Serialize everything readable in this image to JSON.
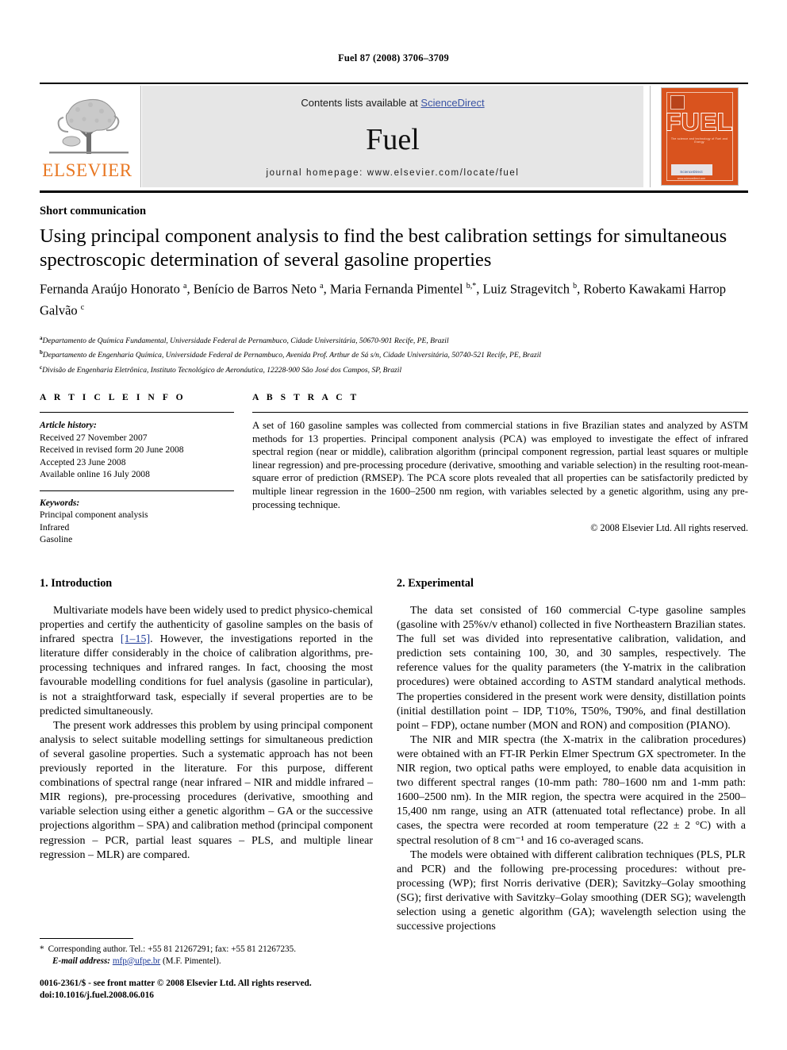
{
  "running_head": "Fuel 87 (2008) 3706–3709",
  "masthead": {
    "publisher_name": "ELSEVIER",
    "publisher_logo_alt": "elsevier-tree-logo",
    "contents_prefix": "Contents lists available at ",
    "contents_link": "ScienceDirect",
    "journal_title": "Fuel",
    "homepage": "journal homepage: www.elsevier.com/locate/fuel",
    "cover": {
      "title": "FUEL",
      "subtitle": "The science and technology of Fuel and Energy",
      "sciencedirect": "ScienceDirect",
      "sciencedirect_label": "available at",
      "url": "www.sciencedirect.com"
    }
  },
  "article": {
    "type": "Short communication",
    "title": "Using principal component analysis to find the best calibration settings for simultaneous spectroscopic determination of several gasoline properties",
    "authors_html": "Fernanda Araújo Honorato <sup>a</sup>, Benício de Barros Neto <sup>a</sup>, Maria Fernanda Pimentel <sup>b,</sup><sup>*</sup>, Luiz Stragevitch <sup>b</sup>, Roberto Kawakami Harrop Galvão <sup>c</sup>",
    "affiliations": [
      "Departamento de Química Fundamental, Universidade Federal de Pernambuco, Cidade Universitária, 50670-901 Recife, PE, Brazil",
      "Departamento de Engenharia Química, Universidade Federal de Pernambuco, Avenida Prof. Arthur de Sá s/n, Cidade Universitária, 50740-521 Recife, PE, Brazil",
      "Divisão de Engenharia Eletrônica, Instituto Tecnológico de Aeronáutica, 12228-900 São José dos Campos, SP, Brazil"
    ],
    "affiliation_marks": [
      "a",
      "b",
      "c"
    ]
  },
  "article_info": {
    "heading": "A R T I C L E   I N F O",
    "history_label": "Article history:",
    "history": [
      "Received 27 November 2007",
      "Received in revised form 20 June 2008",
      "Accepted 23 June 2008",
      "Available online 16 July 2008"
    ],
    "keywords_label": "Keywords:",
    "keywords": [
      "Principal component analysis",
      "Infrared",
      "Gasoline"
    ]
  },
  "abstract": {
    "heading": "A B S T R A C T",
    "text": "A set of 160 gasoline samples was collected from commercial stations in five Brazilian states and analyzed by ASTM methods for 13 properties. Principal component analysis (PCA) was employed to investigate the effect of infrared spectral region (near or middle), calibration algorithm (principal component regression, partial least squares or multiple linear regression) and pre-processing procedure (derivative, smoothing and variable selection) in the resulting root-mean-square error of prediction (RMSEP). The PCA score plots revealed that all properties can be satisfactorily predicted by multiple linear regression in the 1600–2500 nm region, with variables selected by a genetic algorithm, using any pre-processing technique.",
    "copyright": "© 2008 Elsevier Ltd. All rights reserved."
  },
  "sections": {
    "introduction": {
      "heading": "1. Introduction",
      "paragraph_1_pre": "Multivariate models have been widely used to predict physico-chemical properties and certify the authenticity of gasoline samples on the basis of infrared spectra ",
      "paragraph_1_cite": "[1–15]",
      "paragraph_1_post": ". However, the investigations reported in the literature differ considerably in the choice of calibration algorithms, pre-processing techniques and infrared ranges. In fact, choosing the most favourable modelling conditions for fuel analysis (gasoline in particular), is not a straightforward task, especially if several properties are to be predicted simultaneously.",
      "paragraph_2": "The present work addresses this problem by using principal component analysis to select suitable modelling settings for simultaneous prediction of several gasoline properties. Such a systematic approach has not been previously reported in the literature. For this purpose, different combinations of spectral range (near infrared – NIR and middle infrared – MIR regions), pre-processing procedures (derivative, smoothing and variable selection using either a genetic algorithm – GA or the successive projections algorithm – SPA) and calibration method (principal component regression – PCR, partial least squares – PLS, and multiple linear regression – MLR) are compared."
    },
    "experimental": {
      "heading": "2. Experimental",
      "paragraph_1": "The data set consisted of 160 commercial C-type gasoline samples (gasoline with 25%v/v ethanol) collected in five Northeastern Brazilian states. The full set was divided into representative calibration, validation, and prediction sets containing 100, 30, and 30 samples, respectively. The reference values for the quality parameters (the Y-matrix in the calibration procedures) were obtained according to ASTM standard analytical methods. The properties considered in the present work were density, distillation points (initial destillation point – IDP, T10%, T50%, T90%, and final destillation point – FDP), octane number (MON and RON) and composition (PIANO).",
      "paragraph_2": "The NIR and MIR spectra (the X-matrix in the calibration procedures) were obtained with an FT-IR Perkin Elmer Spectrum GX spectrometer. In the NIR region, two optical paths were employed, to enable data acquisition in two different spectral ranges (10-mm path: 780–1600 nm and 1-mm path: 1600–2500 nm). In the MIR region, the spectra were acquired in the 2500–15,400 nm range, using an ATR (attenuated total reflectance) probe. In all cases, the spectra were recorded at room temperature (22 ± 2 °C) with a spectral resolution of 8 cm⁻¹ and 16 co-averaged scans.",
      "paragraph_3": "The models were obtained with different calibration techniques (PLS, PLR and PCR) and the following pre-processing procedures: without pre-processing (WP); first Norris derivative (DER); Savitzky–Golay smoothing (SG); first derivative with Savitzky–Golay smoothing (DER SG); wavelength selection using a genetic algorithm (GA); wavelength selection using the successive projections"
    }
  },
  "footnote": {
    "marker": "*",
    "text": "Corresponding author. Tel.: +55 81 21267291; fax: +55 81 21267235.",
    "email_label": "E-mail address:",
    "email": "mfp@ufpe.br",
    "email_owner": "(M.F. Pimentel)."
  },
  "imprint": {
    "line1": "0016-2361/$ - see front matter © 2008 Elsevier Ltd. All rights reserved.",
    "line2": "doi:10.1016/j.fuel.2008.06.016"
  }
}
